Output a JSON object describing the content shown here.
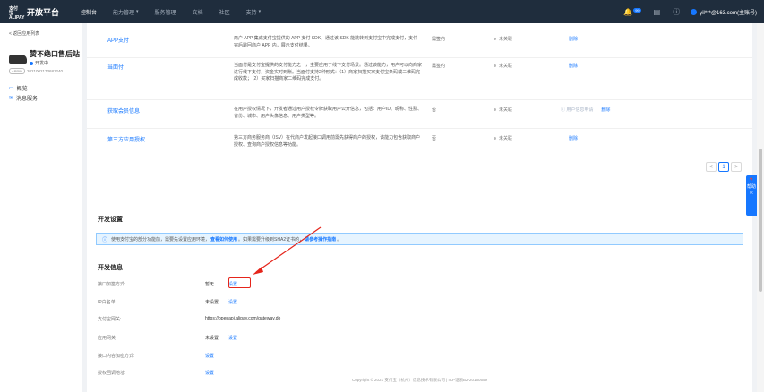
{
  "nav": {
    "brand": "开放平台",
    "brand_logo": "支付宝 ALIPAY",
    "items": [
      {
        "label": "控制台",
        "active": true,
        "caret": false
      },
      {
        "label": "能力管理",
        "active": false,
        "caret": true
      },
      {
        "label": "服务管理",
        "active": false,
        "caret": false
      },
      {
        "label": "文档",
        "active": false,
        "caret": false
      },
      {
        "label": "社区",
        "active": false,
        "caret": false
      },
      {
        "label": "支持",
        "active": false,
        "caret": true
      }
    ],
    "badge": "99",
    "user": "yil***@163.com(主账号)"
  },
  "sidebar": {
    "back": "< 返回应用列表",
    "app_name": "赞不绝口售后站",
    "app_status": "开发中",
    "app_id_tag": "APPID",
    "app_id": "2021002173681240",
    "menu": [
      {
        "label": "概览"
      },
      {
        "label": "消息服务"
      }
    ]
  },
  "abilities": [
    {
      "name": "APP支付",
      "desc": "商户 APP 集成支付宝提供的 APP 支付 SDK，通过该 SDK 能跳转到支付宝中完成支付，支付完后跳回商户 APP 内，展示支付结果。",
      "required": "需签约",
      "status": "未关联",
      "apply": "",
      "op": "删除"
    },
    {
      "name": "当面付",
      "desc": "当面付是支付宝提供的支付能力之一，主要应用于线下支付场景。通过该能力，用户可以向商家进行线下支付，资金实时到账。当面付支持2种形式：（1）商家扫描买家支付宝条码或二维码完成收款；（2）买家扫描商家二维码完成支付。",
      "required": "需签约",
      "status": "未关联",
      "apply": "",
      "op": "删除"
    },
    {
      "name": "获取会员信息",
      "desc": "在用户授权情况下，开发者通过用户授权令牌获取用户公开信息，包括：用户ID、昵称、性别、省份、城市、用户头像信息、用户类型等。",
      "required": "否",
      "status": "未关联",
      "apply": "用户信息申请",
      "op": "删除"
    },
    {
      "name": "第三方应用授权",
      "desc": "第三方商务服务商（ISV）在代商户发起接口调用前需先获得商户的授权，该能力包含获取商户授权、查询商户授权信息等功能。",
      "required": "否",
      "status": "未关联",
      "apply": "",
      "op": "删除"
    }
  ],
  "pager": {
    "prev": "<",
    "current": "1",
    "next": ">"
  },
  "dev_settings": {
    "title": "开发设置",
    "notice_pre": "使用支付宝的部分功能前，需要先设置应用环境，",
    "notice_link1": "查看如何使用",
    "notice_mid": "。如果需要升级到SHA2证书的，",
    "notice_link2": "请参考操作指南",
    "notice_post": "。"
  },
  "dev_info": {
    "title": "开发信息",
    "rows": [
      {
        "label": "接口加签方式:",
        "value": "暂无",
        "action": "设置"
      },
      {
        "label": "IP白名单:",
        "value": "未设置",
        "action": "设置"
      },
      {
        "label": "支付宝网关:",
        "value": "https://openapi.alipay.com/gateway.do",
        "action": ""
      },
      {
        "label": "应用网关:",
        "value": "未设置",
        "action": "设置"
      },
      {
        "label": "接口内容加密方式:",
        "value": "",
        "action": "设置"
      },
      {
        "label": "授权回调地址:",
        "value": "",
        "action": "设置"
      }
    ]
  },
  "footer": "Copyright © 2021 支付宝（杭州）信息技术有限公司 | ICP证浙B2-20160559",
  "float_help": "帮助"
}
